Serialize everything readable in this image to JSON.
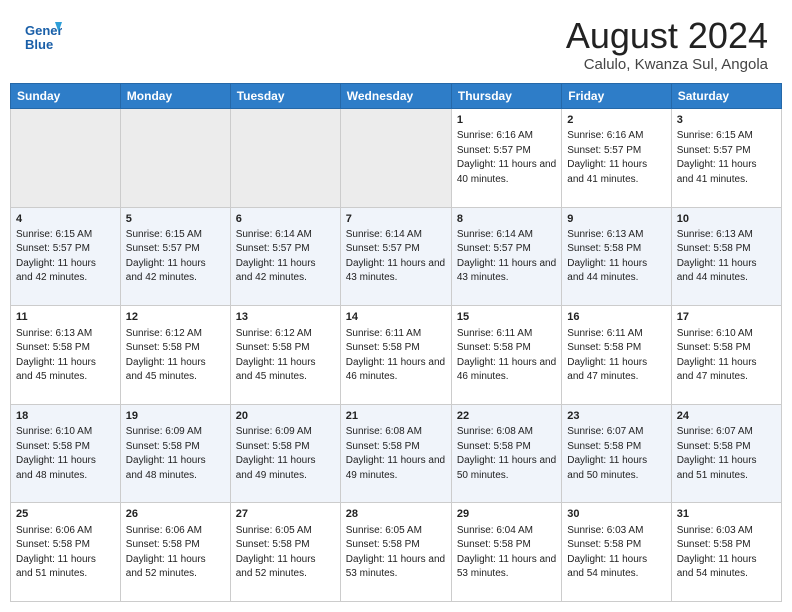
{
  "header": {
    "logo_line1": "General",
    "logo_line2": "Blue",
    "title": "August 2024",
    "subtitle": "Calulo, Kwanza Sul, Angola"
  },
  "days_of_week": [
    "Sunday",
    "Monday",
    "Tuesday",
    "Wednesday",
    "Thursday",
    "Friday",
    "Saturday"
  ],
  "weeks": [
    [
      {
        "day": "",
        "empty": true
      },
      {
        "day": "",
        "empty": true
      },
      {
        "day": "",
        "empty": true
      },
      {
        "day": "",
        "empty": true
      },
      {
        "day": "1",
        "sunrise": "6:16 AM",
        "sunset": "5:57 PM",
        "daylight": "11 hours and 40 minutes."
      },
      {
        "day": "2",
        "sunrise": "6:16 AM",
        "sunset": "5:57 PM",
        "daylight": "11 hours and 41 minutes."
      },
      {
        "day": "3",
        "sunrise": "6:15 AM",
        "sunset": "5:57 PM",
        "daylight": "11 hours and 41 minutes."
      }
    ],
    [
      {
        "day": "4",
        "sunrise": "6:15 AM",
        "sunset": "5:57 PM",
        "daylight": "11 hours and 42 minutes."
      },
      {
        "day": "5",
        "sunrise": "6:15 AM",
        "sunset": "5:57 PM",
        "daylight": "11 hours and 42 minutes."
      },
      {
        "day": "6",
        "sunrise": "6:14 AM",
        "sunset": "5:57 PM",
        "daylight": "11 hours and 42 minutes."
      },
      {
        "day": "7",
        "sunrise": "6:14 AM",
        "sunset": "5:57 PM",
        "daylight": "11 hours and 43 minutes."
      },
      {
        "day": "8",
        "sunrise": "6:14 AM",
        "sunset": "5:57 PM",
        "daylight": "11 hours and 43 minutes."
      },
      {
        "day": "9",
        "sunrise": "6:13 AM",
        "sunset": "5:58 PM",
        "daylight": "11 hours and 44 minutes."
      },
      {
        "day": "10",
        "sunrise": "6:13 AM",
        "sunset": "5:58 PM",
        "daylight": "11 hours and 44 minutes."
      }
    ],
    [
      {
        "day": "11",
        "sunrise": "6:13 AM",
        "sunset": "5:58 PM",
        "daylight": "11 hours and 45 minutes."
      },
      {
        "day": "12",
        "sunrise": "6:12 AM",
        "sunset": "5:58 PM",
        "daylight": "11 hours and 45 minutes."
      },
      {
        "day": "13",
        "sunrise": "6:12 AM",
        "sunset": "5:58 PM",
        "daylight": "11 hours and 45 minutes."
      },
      {
        "day": "14",
        "sunrise": "6:11 AM",
        "sunset": "5:58 PM",
        "daylight": "11 hours and 46 minutes."
      },
      {
        "day": "15",
        "sunrise": "6:11 AM",
        "sunset": "5:58 PM",
        "daylight": "11 hours and 46 minutes."
      },
      {
        "day": "16",
        "sunrise": "6:11 AM",
        "sunset": "5:58 PM",
        "daylight": "11 hours and 47 minutes."
      },
      {
        "day": "17",
        "sunrise": "6:10 AM",
        "sunset": "5:58 PM",
        "daylight": "11 hours and 47 minutes."
      }
    ],
    [
      {
        "day": "18",
        "sunrise": "6:10 AM",
        "sunset": "5:58 PM",
        "daylight": "11 hours and 48 minutes."
      },
      {
        "day": "19",
        "sunrise": "6:09 AM",
        "sunset": "5:58 PM",
        "daylight": "11 hours and 48 minutes."
      },
      {
        "day": "20",
        "sunrise": "6:09 AM",
        "sunset": "5:58 PM",
        "daylight": "11 hours and 49 minutes."
      },
      {
        "day": "21",
        "sunrise": "6:08 AM",
        "sunset": "5:58 PM",
        "daylight": "11 hours and 49 minutes."
      },
      {
        "day": "22",
        "sunrise": "6:08 AM",
        "sunset": "5:58 PM",
        "daylight": "11 hours and 50 minutes."
      },
      {
        "day": "23",
        "sunrise": "6:07 AM",
        "sunset": "5:58 PM",
        "daylight": "11 hours and 50 minutes."
      },
      {
        "day": "24",
        "sunrise": "6:07 AM",
        "sunset": "5:58 PM",
        "daylight": "11 hours and 51 minutes."
      }
    ],
    [
      {
        "day": "25",
        "sunrise": "6:06 AM",
        "sunset": "5:58 PM",
        "daylight": "11 hours and 51 minutes."
      },
      {
        "day": "26",
        "sunrise": "6:06 AM",
        "sunset": "5:58 PM",
        "daylight": "11 hours and 52 minutes."
      },
      {
        "day": "27",
        "sunrise": "6:05 AM",
        "sunset": "5:58 PM",
        "daylight": "11 hours and 52 minutes."
      },
      {
        "day": "28",
        "sunrise": "6:05 AM",
        "sunset": "5:58 PM",
        "daylight": "11 hours and 53 minutes."
      },
      {
        "day": "29",
        "sunrise": "6:04 AM",
        "sunset": "5:58 PM",
        "daylight": "11 hours and 53 minutes."
      },
      {
        "day": "30",
        "sunrise": "6:03 AM",
        "sunset": "5:58 PM",
        "daylight": "11 hours and 54 minutes."
      },
      {
        "day": "31",
        "sunrise": "6:03 AM",
        "sunset": "5:58 PM",
        "daylight": "11 hours and 54 minutes."
      }
    ]
  ]
}
